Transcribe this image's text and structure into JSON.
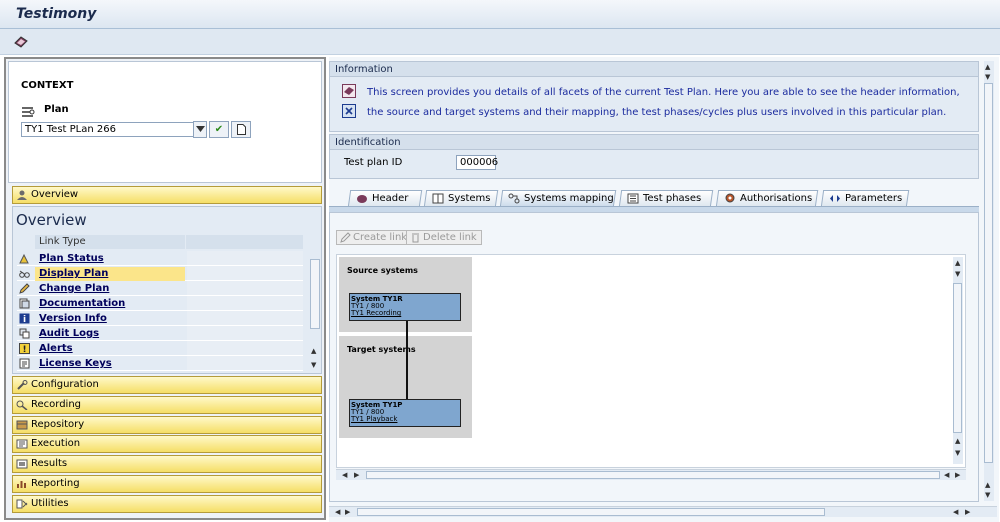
{
  "window": {
    "title": "Testimony"
  },
  "context": {
    "label": "CONTEXT",
    "plan_label": "Plan",
    "plan_value": "TY1 Test PLan 266",
    "confirm_symbol": "✔"
  },
  "nav": {
    "overview_header": "Overview",
    "overview_title": "Overview",
    "link_type_header": "Link Type",
    "links": [
      {
        "label": "Plan Status",
        "icon": "status-icon"
      },
      {
        "label": "Display Plan",
        "icon": "glasses-icon",
        "selected": true
      },
      {
        "label": "Change Plan",
        "icon": "pencil-icon"
      },
      {
        "label": "Documentation",
        "icon": "documentation-icon"
      },
      {
        "label": "Version Info",
        "icon": "info-icon"
      },
      {
        "label": "Audit Logs",
        "icon": "audit-log-icon"
      },
      {
        "label": "Alerts",
        "icon": "alert-icon"
      },
      {
        "label": "License Keys",
        "icon": "license-key-icon"
      }
    ],
    "sections": [
      "Configuration",
      "Recording",
      "Repository",
      "Execution",
      "Results",
      "Reporting",
      "Utilities"
    ]
  },
  "information": {
    "header": "Information",
    "line1": "This screen provides you details of all facets of the current Test Plan. Here you are able to see the header information,",
    "line2": "the source and target systems and their mapping, the test phases/cycles plus users involved in this particular plan."
  },
  "identification": {
    "header": "Identification",
    "field_label": "Test plan ID",
    "field_value": "000006"
  },
  "tabs": [
    {
      "label": "Header"
    },
    {
      "label": "Systems"
    },
    {
      "label": "Systems mapping",
      "active": true
    },
    {
      "label": "Test phases"
    },
    {
      "label": "Authorisations"
    },
    {
      "label": "Parameters"
    }
  ],
  "toolbar": {
    "create_link": "Create link",
    "delete_link": "Delete link"
  },
  "mapping": {
    "source_title": "Source systems",
    "target_title": "Target systems",
    "source_system": {
      "name": "System  TY1R",
      "client": "TY1 / 800",
      "desc": "TY1 Recording"
    },
    "target_system": {
      "name": "System  TY1P",
      "client": "TY1 / 800",
      "desc": "TY1 Playback"
    }
  },
  "colors": {
    "nav_header": "#f5de66",
    "selected_row": "#fbe58a",
    "system_box": "#7fa6cf",
    "link_text": "#00005a"
  }
}
